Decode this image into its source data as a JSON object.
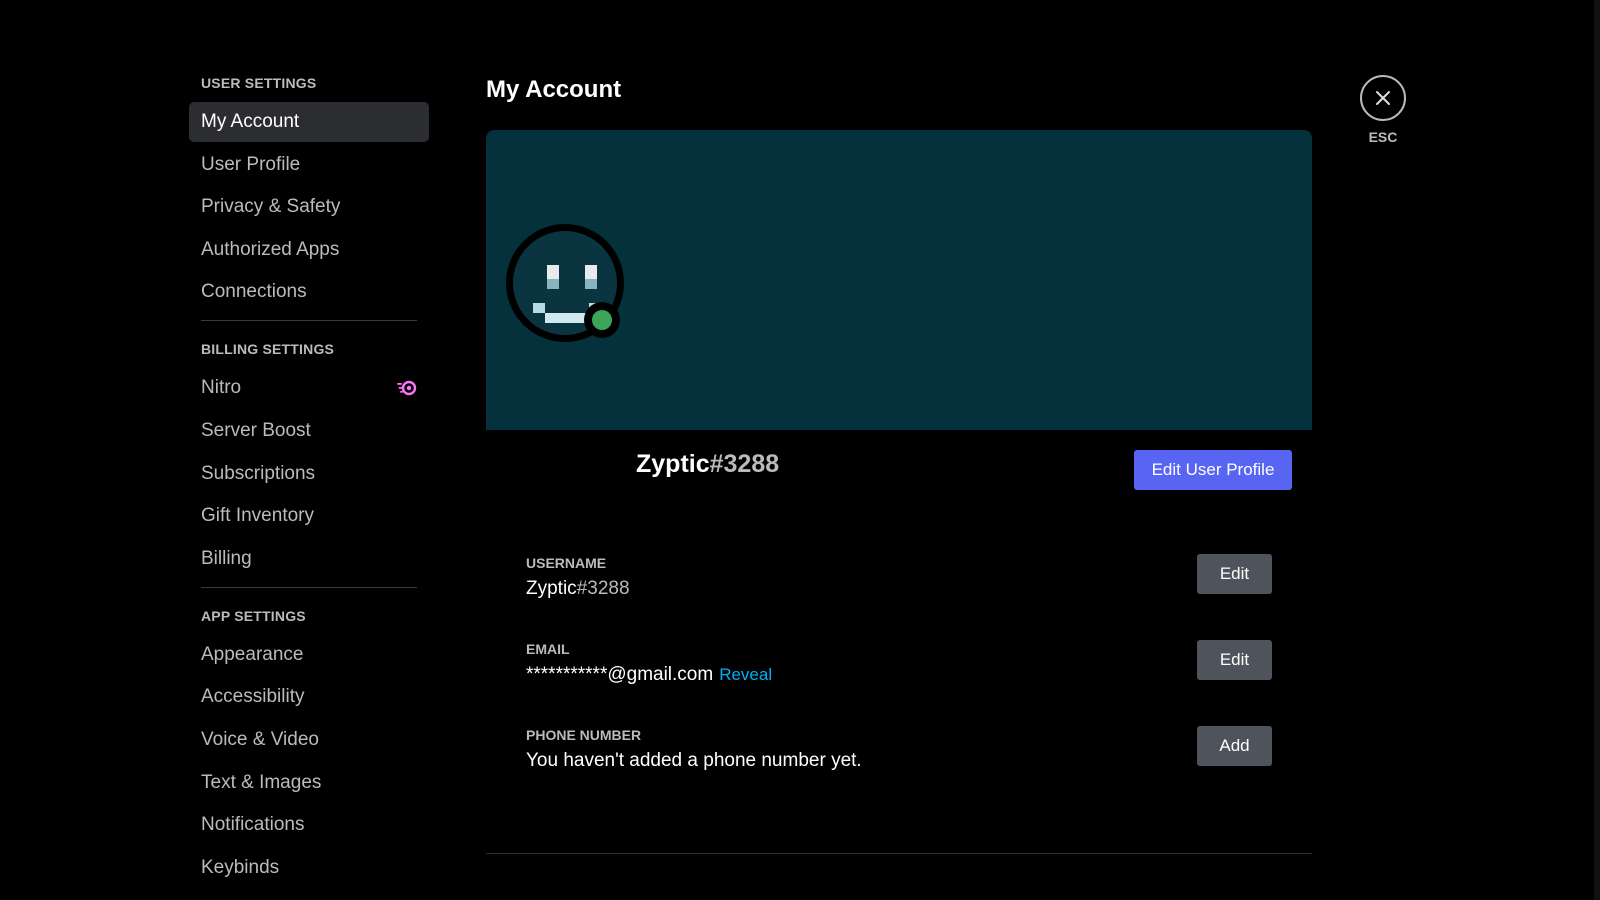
{
  "sidebar": {
    "user_settings_header": "USER SETTINGS",
    "user_items": [
      {
        "label": "My Account"
      },
      {
        "label": "User Profile"
      },
      {
        "label": "Privacy & Safety"
      },
      {
        "label": "Authorized Apps"
      },
      {
        "label": "Connections"
      }
    ],
    "billing_settings_header": "BILLING SETTINGS",
    "billing_items": [
      {
        "label": "Nitro",
        "icon": "nitro-icon"
      },
      {
        "label": "Server Boost"
      },
      {
        "label": "Subscriptions"
      },
      {
        "label": "Gift Inventory"
      },
      {
        "label": "Billing"
      }
    ],
    "app_settings_header": "APP SETTINGS",
    "app_items": [
      {
        "label": "Appearance"
      },
      {
        "label": "Accessibility"
      },
      {
        "label": "Voice & Video"
      },
      {
        "label": "Text & Images"
      },
      {
        "label": "Notifications"
      },
      {
        "label": "Keybinds"
      }
    ]
  },
  "main": {
    "title": "My Account",
    "profile": {
      "username": "Zyptic",
      "discriminator": "#3288",
      "status": "online",
      "edit_profile_label": "Edit User Profile"
    },
    "fields": {
      "username_label": "USERNAME",
      "username_value": "Zyptic",
      "username_disc": "#3288",
      "username_button": "Edit",
      "email_label": "EMAIL",
      "email_value": "***********@gmail.com",
      "email_reveal": "Reveal",
      "email_button": "Edit",
      "phone_label": "PHONE NUMBER",
      "phone_value": "You haven't added a phone number yet.",
      "phone_button": "Add"
    }
  },
  "close": {
    "label": "ESC",
    "icon": "close-icon"
  },
  "colors": {
    "background": "#000000",
    "banner": "#05313c",
    "accent": "#5865f2",
    "link": "#00aff4",
    "online": "#3ba55c",
    "nitro": "#ff73fa"
  }
}
